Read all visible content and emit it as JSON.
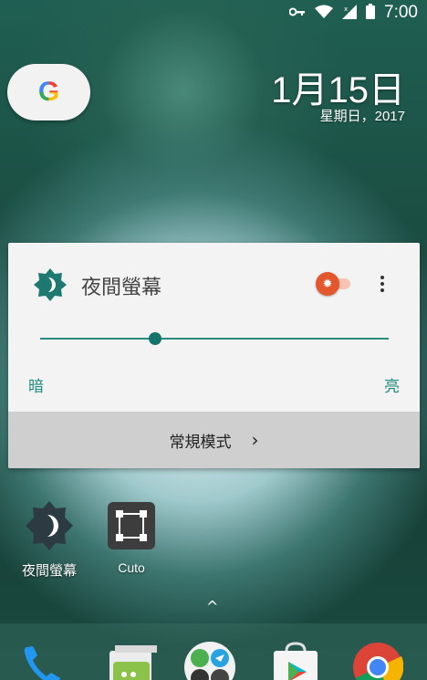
{
  "status_bar": {
    "time": "7:00",
    "icons": [
      "vpn-key-icon",
      "wifi-icon",
      "signal-icon",
      "battery-icon"
    ]
  },
  "google_search": {
    "letter": "G",
    "icon": "google-icon"
  },
  "clock": {
    "date": "1月15日",
    "weekday_year": "星期日，2017"
  },
  "night_screen_widget": {
    "title": "夜間螢幕",
    "icon": "moon-gear-icon",
    "toggle_on": true,
    "toggle_icon": "sun-icon",
    "more_icon": "more-vert-icon",
    "brightness_level": 0.33,
    "label_dark": "暗",
    "label_bright": "亮",
    "mode_label": "常規模式",
    "mode_chevron": "›",
    "accent_color": "#1e8a7e",
    "toggle_color": "#e2572b"
  },
  "home_apps": [
    {
      "label": "夜間螢幕",
      "icon": "night-screen-icon"
    },
    {
      "label": "Cuto",
      "icon": "cuto-icon"
    }
  ],
  "drawer_handle": "^",
  "dock": [
    {
      "icon": "phone-icon"
    },
    {
      "icon": "messages-icon"
    },
    {
      "icon": "app-folder-icon"
    },
    {
      "icon": "play-store-icon"
    },
    {
      "icon": "chrome-icon"
    }
  ]
}
